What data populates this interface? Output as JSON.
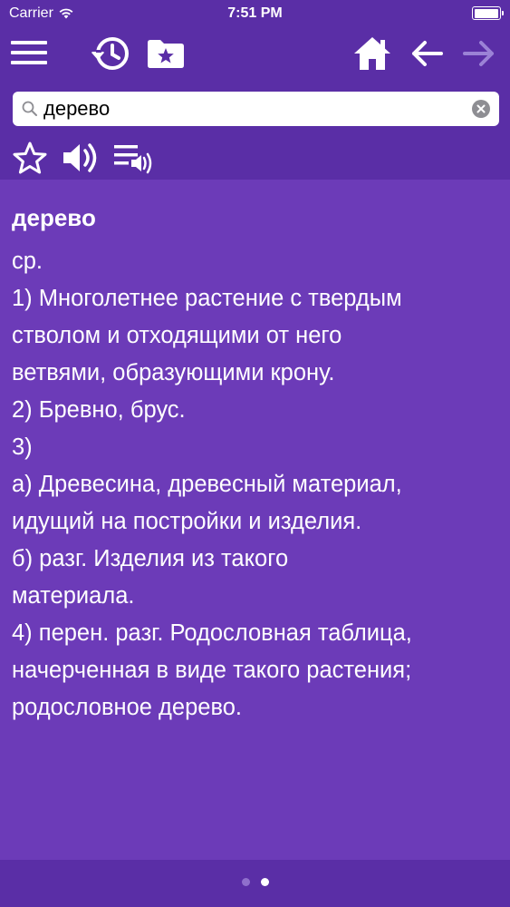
{
  "status_bar": {
    "carrier": "Carrier",
    "time": "7:51 PM",
    "battery_level": 0.9
  },
  "toolbar": {
    "icons": [
      "hamburger-menu-icon",
      "history-icon",
      "favorites-folder-icon",
      "home-icon",
      "back-arrow-icon",
      "forward-arrow-icon"
    ],
    "forward_enabled": false
  },
  "search": {
    "value": "дерево",
    "placeholder": ""
  },
  "actions": {
    "icons": [
      "star-icon",
      "speaker-icon",
      "play-list-audio-icon"
    ]
  },
  "entry": {
    "headword": "дерево",
    "lines": [
      "ср.",
      "1) Многолетнее растение с твердым",
      "стволом и отходящими от него",
      "ветвями, образующими крону.",
      "2) Бревно, брус.",
      "3)",
      "а) Древесина, древесный материал,",
      "идущий на постройки и изделия.",
      "б) разг. Изделия из такого",
      "материала.",
      "4) перен. разг. Родословная таблица,",
      "начерченная в виде такого растения;",
      "родословное дерево."
    ]
  },
  "pagination": {
    "pages": 2,
    "current": 2
  },
  "colors": {
    "header_bg": "#5a2ea6",
    "content_bg": "#6c3bb8",
    "disabled_icon": "#9b82d6"
  }
}
